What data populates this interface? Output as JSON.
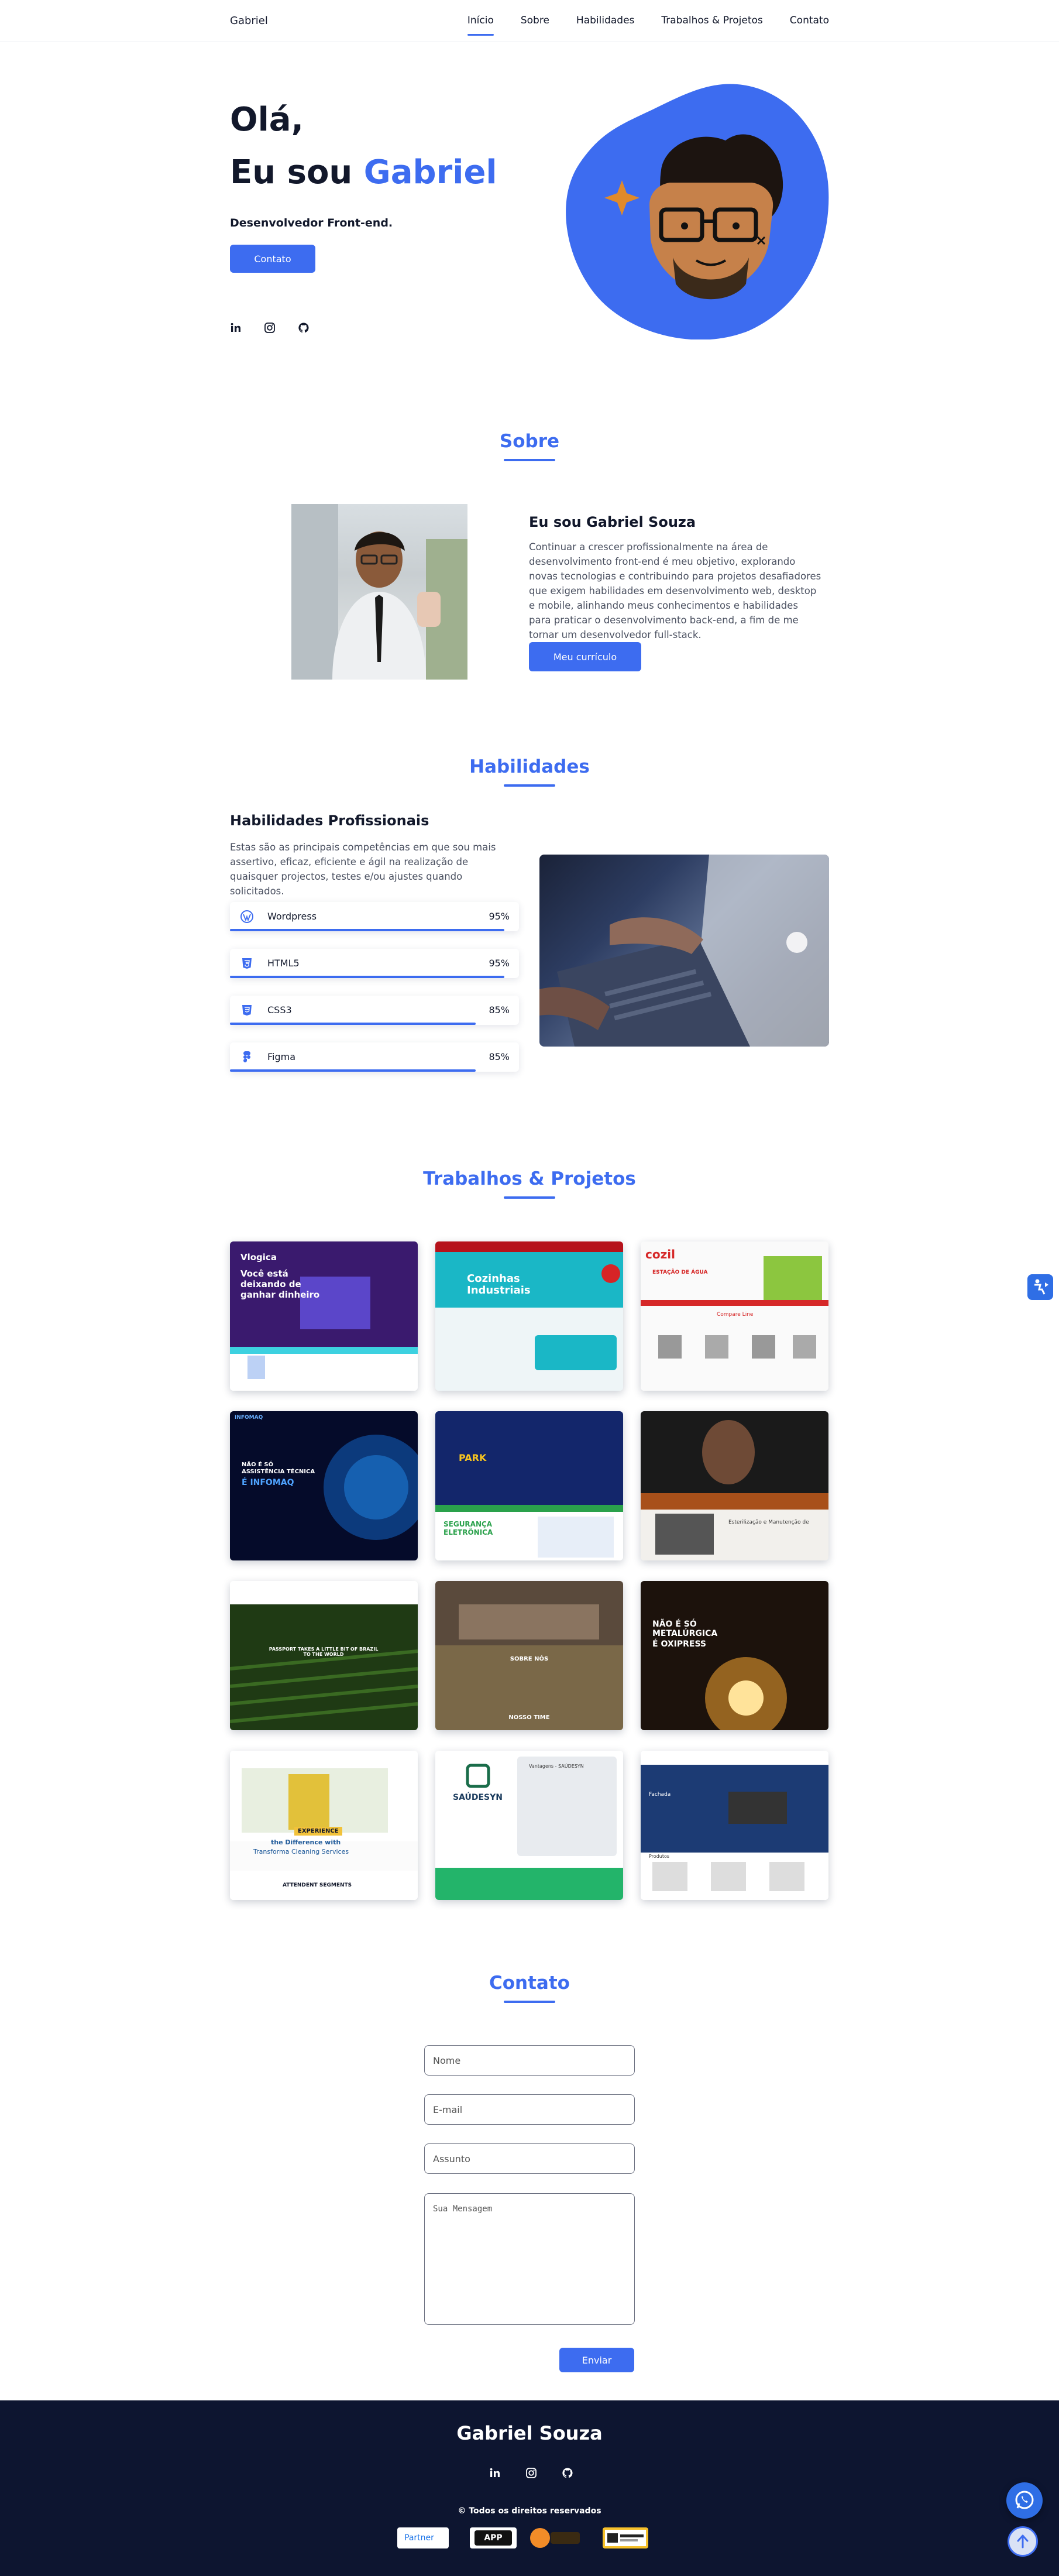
{
  "nav": {
    "brand": "Gabriel",
    "links": [
      "Início",
      "Sobre",
      "Habilidades",
      "Trabalhos & Projetos",
      "Contato"
    ],
    "active": "Início"
  },
  "hero": {
    "greeting": "Olá,",
    "intro_prefix": "Eu sou",
    "name": "Gabriel",
    "role": "Desenvolvedor Front-end.",
    "cta": "Contato",
    "socials": [
      "linkedin-icon",
      "instagram-icon",
      "github-icon"
    ]
  },
  "about": {
    "title": "Sobre",
    "heading": "Eu sou Gabriel Souza",
    "text": "Continuar a crescer profissionalmente na área de desenvolvimento front-end é meu objetivo, explorando novas tecnologias e contribuindo para projetos desafiadores que exigem habilidades em desenvolvimento web, desktop e mobile, alinhando meus conhecimentos e habilidades para praticar o desenvolvimento back-end, a fim de me tornar um desenvolvedor full-stack.",
    "cv_button": "Meu currículo"
  },
  "skills": {
    "title": "Habilidades",
    "heading": "Habilidades Profissionais",
    "text": "Estas são as principais competências em que sou mais assertivo, eficaz, eficiente e ágil na realização de quaisquer projectos, testes e/ou ajustes quando solicitados.",
    "items": [
      {
        "name": "Wordpress",
        "percent": "95%",
        "level": 0.95,
        "icon": "wordpress-icon"
      },
      {
        "name": "HTML5",
        "percent": "95%",
        "level": 0.95,
        "icon": "html5-icon"
      },
      {
        "name": "CSS3",
        "percent": "85%",
        "level": 0.85,
        "icon": "css3-icon"
      },
      {
        "name": "Figma",
        "percent": "85%",
        "level": 0.85,
        "icon": "figma-icon"
      }
    ]
  },
  "projects": {
    "title": "Trabalhos & Projetos",
    "cards": [
      {
        "texts": [
          "Vlogica",
          "Você está deixando de ganhar dinheiro"
        ]
      },
      {
        "texts": [
          "Cozinhas Industriais"
        ]
      },
      {
        "texts": [
          "cozil",
          "ESTAÇÃO DE ÁGUA",
          "Compare Line"
        ]
      },
      {
        "texts": [
          "INFOMAQ",
          "NÃO É SÓ ASSISTÊNCIA TÉCNICA",
          "É INFOMAQ"
        ]
      },
      {
        "texts": [
          "PARK",
          "SEGURANÇA ELETRÔNICA"
        ]
      },
      {
        "texts": [
          "Esterilização e Manutenção de"
        ]
      },
      {
        "texts": [
          "PASSPORT TAKES A LITTLE BIT OF BRAZIL TO THE WORLD"
        ]
      },
      {
        "texts": [
          "SOBRE NÓS",
          "NOSSO TIME"
        ]
      },
      {
        "texts": [
          "NÃO É SÓ METALÚRGICA",
          "É OXIPRESS"
        ]
      },
      {
        "texts": [
          "EXPERIENCE",
          "the Difference with",
          "Transforma Cleaning Services",
          "ATTENDENT SEGMENTS"
        ]
      },
      {
        "texts": [
          "SAÚDESYN",
          "Vantagens - SAÚDESYN"
        ]
      },
      {
        "texts": [
          "Fachada",
          "Produtos"
        ]
      }
    ]
  },
  "contact": {
    "title": "Contato",
    "name_placeholder": "Nome",
    "email_placeholder": "E-mail",
    "subject_placeholder": "Assunto",
    "message_placeholder": "Sua Mensagem",
    "submit": "Enviar"
  },
  "footer": {
    "name": "Gabriel Souza",
    "copyright": "© Todos os direitos reservados",
    "badges": [
      "Partner",
      "APP"
    ]
  },
  "colors": {
    "accent": "#3d6cf0",
    "footer_bg": "#0d1530",
    "text": "#12182b"
  }
}
